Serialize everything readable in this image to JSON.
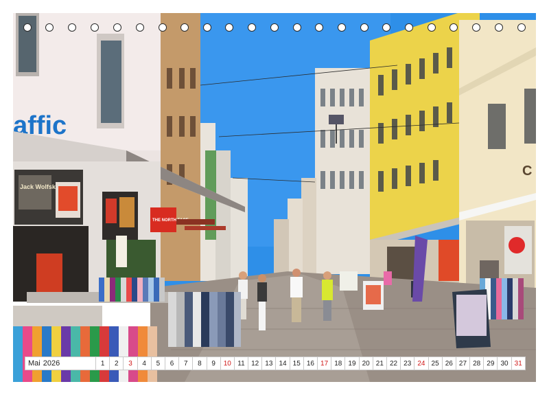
{
  "photo": {
    "shop_signs": [
      "affic",
      "Jack Wolfskin",
      "THE NORTH FACE",
      "C"
    ],
    "sky_color": "#2e8fe8",
    "cobblestone_color": "#9a8f86"
  },
  "calendar": {
    "month": "Mai",
    "year": "2026",
    "days": [
      {
        "n": "1",
        "sun": false
      },
      {
        "n": "2",
        "sun": false
      },
      {
        "n": "3",
        "sun": true
      },
      {
        "n": "4",
        "sun": false
      },
      {
        "n": "5",
        "sun": false
      },
      {
        "n": "6",
        "sun": false
      },
      {
        "n": "7",
        "sun": false
      },
      {
        "n": "8",
        "sun": false
      },
      {
        "n": "9",
        "sun": false
      },
      {
        "n": "10",
        "sun": true
      },
      {
        "n": "11",
        "sun": false
      },
      {
        "n": "12",
        "sun": false
      },
      {
        "n": "13",
        "sun": false
      },
      {
        "n": "14",
        "sun": false
      },
      {
        "n": "15",
        "sun": false
      },
      {
        "n": "16",
        "sun": false
      },
      {
        "n": "17",
        "sun": true
      },
      {
        "n": "18",
        "sun": false
      },
      {
        "n": "19",
        "sun": false
      },
      {
        "n": "20",
        "sun": false
      },
      {
        "n": "21",
        "sun": false
      },
      {
        "n": "22",
        "sun": false
      },
      {
        "n": "23",
        "sun": false
      },
      {
        "n": "24",
        "sun": true
      },
      {
        "n": "25",
        "sun": false
      },
      {
        "n": "26",
        "sun": false
      },
      {
        "n": "27",
        "sun": false
      },
      {
        "n": "28",
        "sun": false
      },
      {
        "n": "29",
        "sun": false
      },
      {
        "n": "30",
        "sun": false
      },
      {
        "n": "31",
        "sun": true
      }
    ]
  }
}
